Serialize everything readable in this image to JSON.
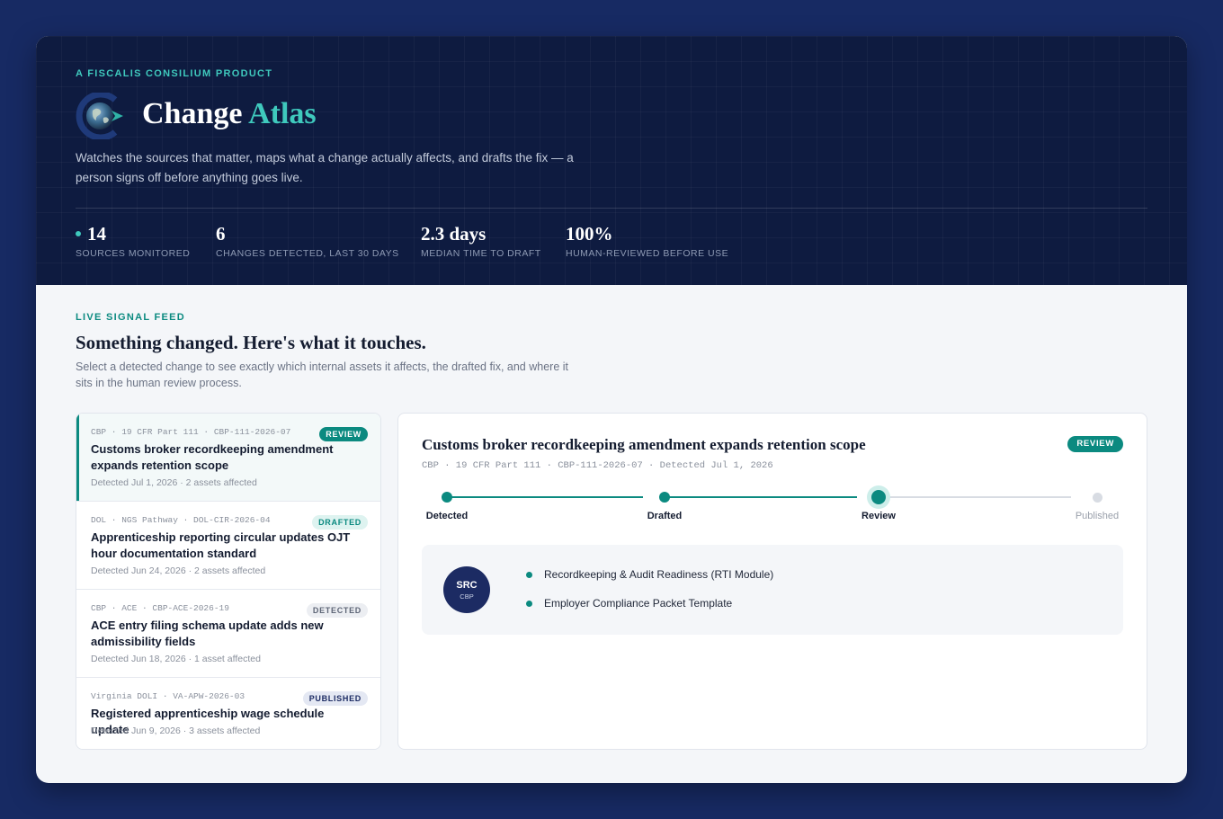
{
  "hero": {
    "eyebrow": "A FISCALIS CONSILIUM PRODUCT",
    "brand_main": "Change",
    "brand_accent": "Atlas",
    "description": "Watches the sources that matter, maps what a change actually affects, and drafts the fix — a person signs off before anything goes live.",
    "stats": [
      {
        "value": "14",
        "label": "SOURCES MONITORED"
      },
      {
        "value": "6",
        "label": "CHANGES DETECTED, LAST 30 DAYS"
      },
      {
        "value": "2.3 days",
        "label": "MEDIAN TIME TO DRAFT"
      },
      {
        "value": "100%",
        "label": "HUMAN-REVIEWED BEFORE USE"
      }
    ]
  },
  "feed_section": {
    "eyebrow": "LIVE SIGNAL FEED",
    "title": "Something changed. Here's what it touches.",
    "description": "Select a detected change to see exactly which internal assets it affects, the drafted fix, and where it sits in the human review process."
  },
  "feed": [
    {
      "meta": "CBP · 19 CFR Part 111 · CBP-111-2026-07",
      "status": "REVIEW",
      "title": "Customs broker recordkeeping amendment expands retention scope",
      "detected": "Detected Jul 1, 2026 · 2 assets affected"
    },
    {
      "meta": "DOL · NGS Pathway · DOL-CIR-2026-04",
      "status": "DRAFTED",
      "title": "Apprenticeship reporting circular updates OJT hour documentation standard",
      "detected": "Detected Jun 24, 2026 · 2 assets affected"
    },
    {
      "meta": "CBP · ACE · CBP-ACE-2026-19",
      "status": "DETECTED",
      "title": "ACE entry filing schema update adds new admissibility fields",
      "detected": "Detected Jun 18, 2026 · 1 asset affected"
    },
    {
      "meta": "Virginia DOLI · VA-APW-2026-03",
      "status": "PUBLISHED",
      "title": "Registered apprenticeship wage schedule update",
      "detected": "Detected Jun 9, 2026 · 3 assets affected"
    }
  ],
  "detail": {
    "title": "Customs broker recordkeeping amendment expands retention scope",
    "meta": "CBP · 19 CFR Part 111 · CBP-111-2026-07 · Detected Jul 1, 2026",
    "status": "REVIEW",
    "steps": [
      "Detected",
      "Drafted",
      "Review",
      "Published"
    ],
    "current_step": 2,
    "source_badge": {
      "top": "SRC",
      "bottom": "CBP"
    },
    "affected_assets": [
      "Recordkeeping & Audit Readiness (RTI Module)",
      "Employer Compliance Packet Template"
    ]
  },
  "colors": {
    "page_bg": "#172a63",
    "hero_bg": "#0e1b40",
    "accent_teal": "#3fc9bd",
    "status_teal": "#0b8a80",
    "navy": "#1c2b63"
  },
  "icons": {
    "logo": "globe-arrow-icon"
  }
}
